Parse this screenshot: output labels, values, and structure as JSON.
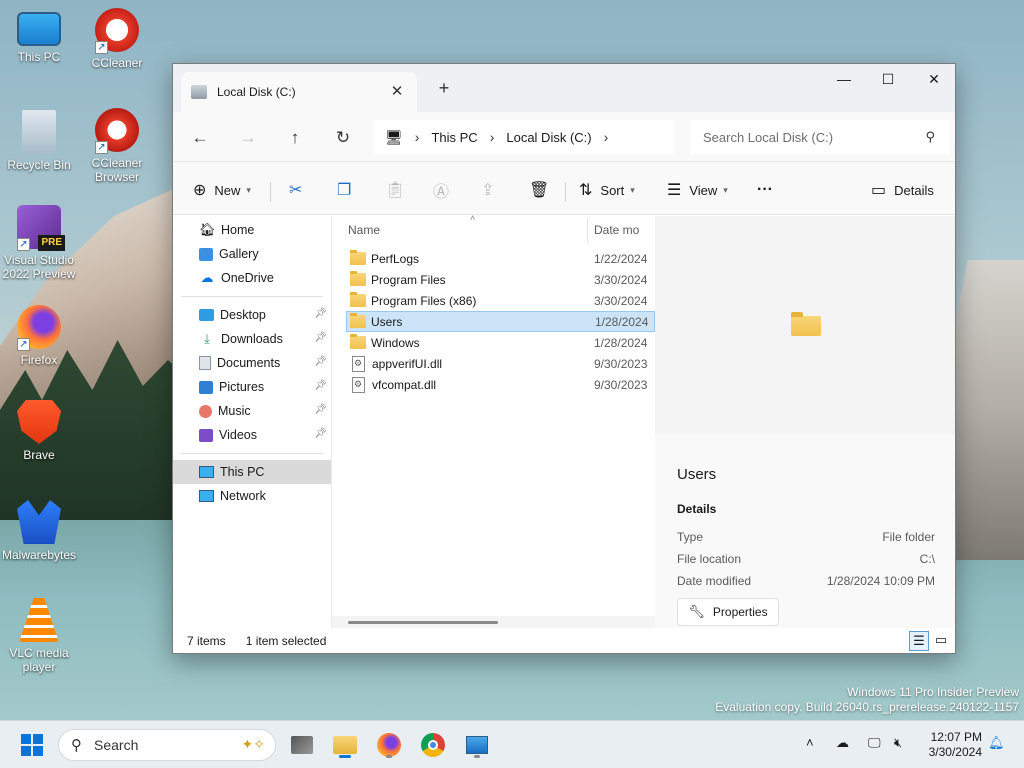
{
  "desktop": {
    "icons": [
      {
        "label": "This PC"
      },
      {
        "label": "CCleaner"
      },
      {
        "label": "Recycle Bin"
      },
      {
        "label": "CCleaner Browser"
      },
      {
        "label": "Visual Studio 2022 Preview"
      },
      {
        "label": "Firefox"
      },
      {
        "label": "Brave"
      },
      {
        "label": "Malwarebytes"
      },
      {
        "label": "VLC media player"
      }
    ],
    "vs_badge": "PRE",
    "watermark": {
      "line1": "Windows 11 Pro Insider Preview",
      "line2": "Evaluation copy. Build 26040.rs_prerelease.240122-1157"
    }
  },
  "window": {
    "tab_title": "Local Disk (C:)",
    "new_tab_symbol": "+",
    "address": {
      "crumbs": [
        "This PC",
        "Local Disk (C:)"
      ]
    },
    "search_placeholder": "Search Local Disk (C:)",
    "toolbar": {
      "new_label": "New",
      "sort_label": "Sort",
      "view_label": "View",
      "more_label": "···",
      "details_label": "Details"
    },
    "nav": {
      "top": [
        {
          "label": "Home",
          "icon": "home-icon"
        },
        {
          "label": "Gallery",
          "icon": "gallery-icon"
        },
        {
          "label": "OneDrive",
          "icon": "onedrive-icon"
        }
      ],
      "quick": [
        {
          "label": "Desktop",
          "icon": "desktop-icon"
        },
        {
          "label": "Downloads",
          "icon": "download-icon"
        },
        {
          "label": "Documents",
          "icon": "document-icon"
        },
        {
          "label": "Pictures",
          "icon": "pictures-icon"
        },
        {
          "label": "Music",
          "icon": "music-icon"
        },
        {
          "label": "Videos",
          "icon": "video-icon"
        }
      ],
      "bottom": [
        {
          "label": "This PC",
          "icon": "pc-icon",
          "selected": true
        },
        {
          "label": "Network",
          "icon": "network-icon"
        }
      ]
    },
    "columns": {
      "name": "Name",
      "date": "Date mo"
    },
    "files": [
      {
        "name": "PerfLogs",
        "date": "1/22/2024",
        "type": "folder"
      },
      {
        "name": "Program Files",
        "date": "3/30/2024",
        "type": "folder"
      },
      {
        "name": "Program Files (x86)",
        "date": "3/30/2024",
        "type": "folder"
      },
      {
        "name": "Users",
        "date": "1/28/2024",
        "type": "folder",
        "selected": true
      },
      {
        "name": "Windows",
        "date": "1/28/2024",
        "type": "folder"
      },
      {
        "name": "appverifUI.dll",
        "date": "9/30/2023",
        "type": "dll"
      },
      {
        "name": "vfcompat.dll",
        "date": "9/30/2023",
        "type": "dll"
      }
    ],
    "details_pane": {
      "title": "Users",
      "section": "Details",
      "props": [
        {
          "k": "Type",
          "v": "File folder"
        },
        {
          "k": "File location",
          "v": "C:\\"
        },
        {
          "k": "Date modified",
          "v": "1/28/2024 10:09 PM"
        }
      ],
      "properties_button": "Properties"
    },
    "status": {
      "items": "7 items",
      "selected": "1 item selected"
    }
  },
  "taskbar": {
    "search_label": "Search",
    "clock_time": "12:07 PM",
    "clock_date": "3/30/2024"
  }
}
